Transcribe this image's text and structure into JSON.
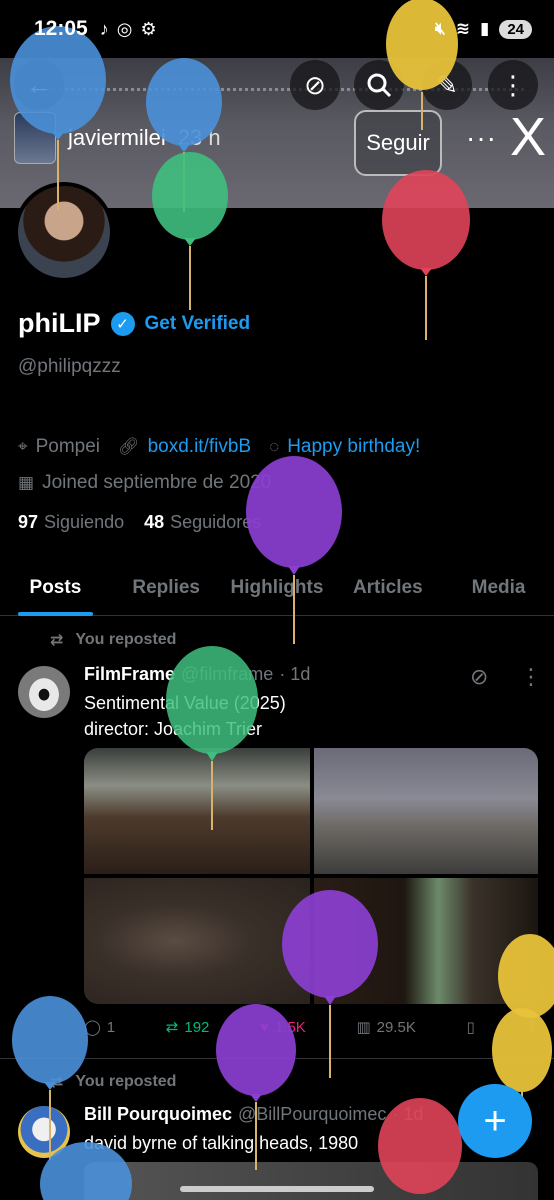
{
  "status_bar": {
    "time": "12:05",
    "battery": "24",
    "icons": [
      "tiktok-icon",
      "instagram-icon",
      "bike-icon"
    ],
    "right_icons": [
      "mute-icon",
      "wifi-icon",
      "signal-icon"
    ]
  },
  "header": {
    "story_user": "javiermilei",
    "story_time": "23 h",
    "follow_label": "Seguir",
    "more": "···",
    "close": "X",
    "buttons": [
      "back-icon",
      "grok-icon",
      "search-icon",
      "edit-icon",
      "more-icon"
    ]
  },
  "profile": {
    "name": "phiLIP",
    "get_verified": "Get Verified",
    "handle": "@philipqzzz",
    "location": "Pompei",
    "link": "boxd.it/fivbB",
    "birthday": "Happy birthday!",
    "joined": "Joined septiembre de 2020",
    "following_count": "97",
    "following_label": "Siguiendo",
    "followers_count": "48",
    "followers_label": "Seguidores"
  },
  "tabs": [
    "Posts",
    "Replies",
    "Highlights",
    "Articles",
    "Media"
  ],
  "posts": [
    {
      "repost_label": "You reposted",
      "author": "FilmFrame",
      "handle": "@filmframe",
      "time": "· 1d",
      "text_line1": "Sentimental Value (2025)",
      "text_line2": "director: Joachim Trier",
      "replies": "1",
      "reposts": "192",
      "likes": "1.5K",
      "views": "29.5K"
    },
    {
      "repost_label": "You reposted",
      "author": "Bill Pourquoimec",
      "handle": "@BillPourquoimec",
      "time": "· 1d",
      "text_line1": "david byrne of talking heads, 1980"
    }
  ],
  "fab": "+",
  "colors": {
    "accent": "#1d9bf0",
    "repost": "#00ba7c",
    "like": "#f91880",
    "muted": "#71767b",
    "background": "#000000"
  },
  "balloons": [
    "blue",
    "blue",
    "green",
    "yellow",
    "red",
    "purple",
    "green",
    "purple",
    "purple",
    "blue",
    "yellow",
    "red",
    "blue"
  ]
}
